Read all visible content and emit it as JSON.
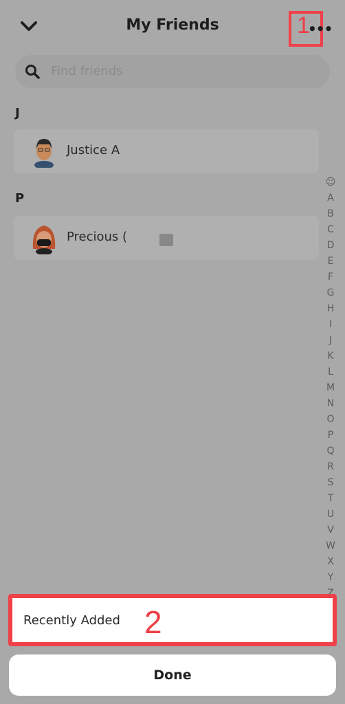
{
  "header": {
    "title": "My Friends",
    "back_icon": "chevron-down-icon",
    "more_icon": "ellipsis-icon",
    "more_label": "•••",
    "annotation_1": "1"
  },
  "search": {
    "placeholder": "Find friends",
    "icon": "search-icon"
  },
  "sections": [
    {
      "letter": "J",
      "friends": [
        {
          "name": "Justice A",
          "avatar": "bitmoji-avatar"
        }
      ]
    },
    {
      "letter": "P",
      "friends": [
        {
          "name": "Precious (",
          "avatar": "bitmoji-avatar"
        }
      ]
    }
  ],
  "index": [
    "☺",
    "A",
    "B",
    "C",
    "D",
    "E",
    "F",
    "G",
    "H",
    "I",
    "J",
    "K",
    "L",
    "M",
    "N",
    "O",
    "P",
    "Q",
    "R",
    "S",
    "T",
    "U",
    "V",
    "W",
    "X",
    "Y",
    "Z"
  ],
  "menu": {
    "recently_added": "Recently Added",
    "annotation_2": "2",
    "done": "Done"
  },
  "colors": {
    "annotation": "#ef4149",
    "overlay": "#a9a9a9"
  }
}
